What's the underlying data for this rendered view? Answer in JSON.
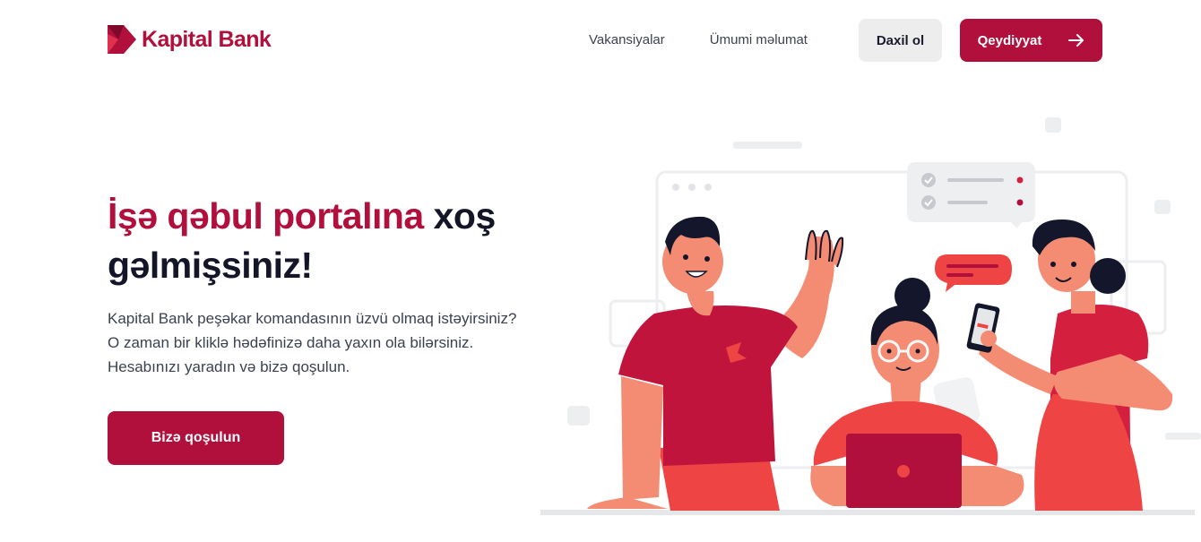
{
  "brand": {
    "name": "Kapital Bank",
    "logo_icon": "kapital-bank-k-logo",
    "color": "#b10f3c"
  },
  "nav": {
    "items": [
      {
        "label": "Vakansiyalar"
      },
      {
        "label": "Ümumi məlumat"
      }
    ]
  },
  "auth": {
    "login_label": "Daxil ol",
    "register_label": "Qeydiyyat",
    "register_icon": "arrow-right-icon"
  },
  "hero": {
    "title_accent": "İşə qəbul portalına",
    "title_rest": " xoş gəlmişsiniz!",
    "text_lines": [
      "Kapital Bank peşəkar komandasının üzvü olmaq istəyirsiniz?",
      "O zaman bir kliklə hədəfinizə daha yaxın ola bilərsiniz.",
      "Hesabınızı yaradın və bizə qoşulun."
    ],
    "cta_label": "Bizə qoşulun"
  },
  "colors": {
    "accent": "#b10f3c",
    "skin": "#f48b73",
    "shirt": "#d41f3f",
    "light_bg": "#ededee"
  }
}
